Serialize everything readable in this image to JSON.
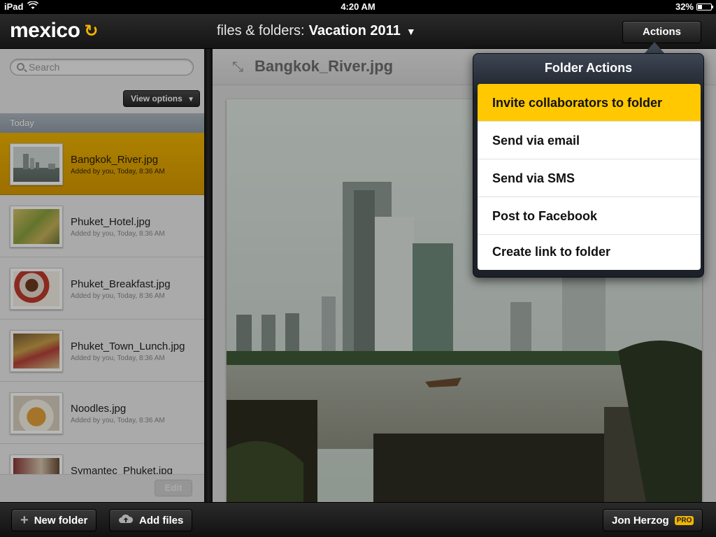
{
  "status_bar": {
    "device": "iPad",
    "time": "4:20 AM",
    "battery": "32%",
    "battery_level": 0.32
  },
  "app": {
    "name": "mexico",
    "logo_icon": "sync-icon"
  },
  "nav": {
    "prefix": "files & folders:",
    "folder": "Vacation 2011",
    "actions_label": "Actions"
  },
  "search": {
    "placeholder": "Search"
  },
  "left": {
    "view_options": "View options",
    "section": "Today",
    "edit_label": "Edit"
  },
  "files": [
    {
      "name": "Bangkok_River.jpg",
      "meta": "Added by you, Today, 8:36 AM",
      "selected": true
    },
    {
      "name": "Phuket_Hotel.jpg",
      "meta": "Added by you, Today, 8:36 AM"
    },
    {
      "name": "Phuket_Breakfast.jpg",
      "meta": "Added by you, Today, 8:36 AM"
    },
    {
      "name": "Phuket_Town_Lunch.jpg",
      "meta": "Added by you, Today, 8:36 AM"
    },
    {
      "name": "Noodles.jpg",
      "meta": "Added by you, Today, 8:36 AM"
    },
    {
      "name": "Symantec_Phuket.jpg",
      "meta": ""
    }
  ],
  "preview": {
    "title": "Bangkok_River.jpg"
  },
  "popover": {
    "title": "Folder Actions",
    "items": [
      "Invite collaborators to folder",
      "Send via email",
      "Send via SMS",
      "Post to Facebook",
      "Create link to folder"
    ]
  },
  "bottom": {
    "new_folder": "New folder",
    "add_files": "Add files",
    "user": "Jon Herzog",
    "badge": "PRO"
  },
  "colors": {
    "accent": "#f2b400",
    "highlight": "#ffc800",
    "dark": "#1c1c1c"
  }
}
